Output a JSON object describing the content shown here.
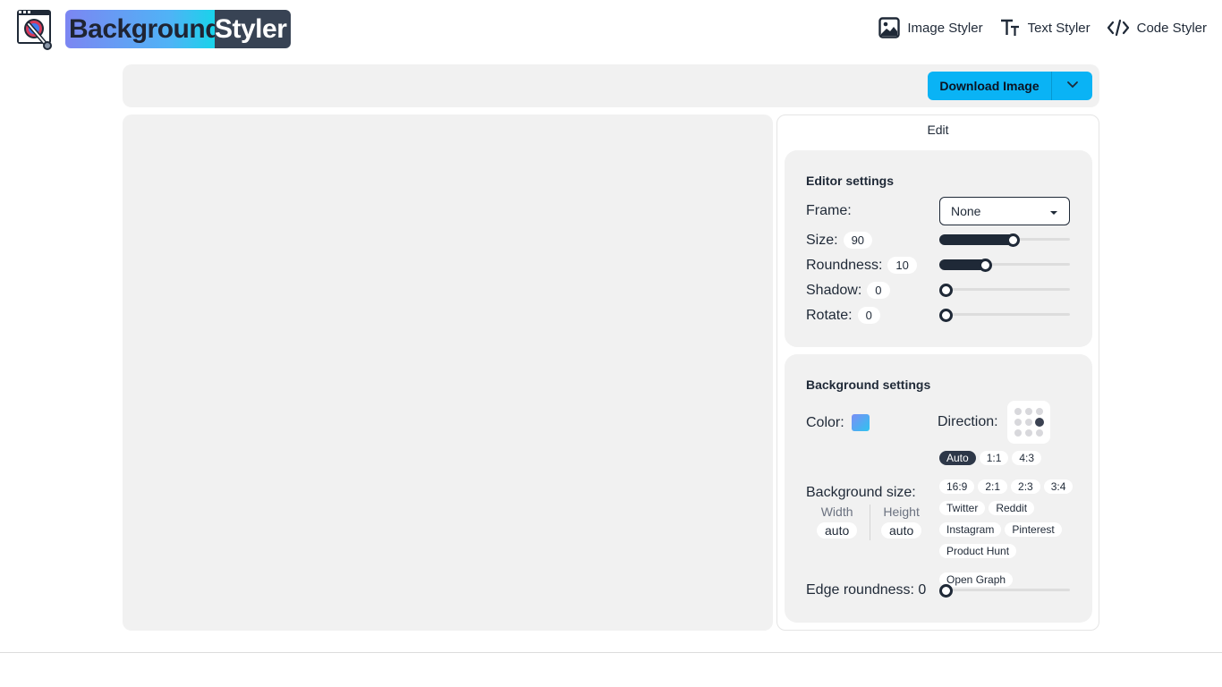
{
  "app": {
    "logo_part1": "Background",
    "logo_part2": "Styler"
  },
  "nav": [
    {
      "label": "Image Styler",
      "icon": "image-icon"
    },
    {
      "label": "Text Styler",
      "icon": "text-icon"
    },
    {
      "label": "Code Styler",
      "icon": "code-icon"
    }
  ],
  "toolbar": {
    "download_label": "Download Image",
    "caret_icon": "chevron-down-icon",
    "accent_color": "#0ab3f5"
  },
  "panel": {
    "tab_label": "Edit",
    "editor": {
      "title": "Editor settings",
      "frame_label": "Frame:",
      "frame_value": "None",
      "size_label": "Size:",
      "size_value": "90",
      "size_fraction": 0.56,
      "roundness_label": "Roundness:",
      "roundness_value": "10",
      "roundness_fraction": 0.35,
      "shadow_label": "Shadow:",
      "shadow_value": "0",
      "rotate_label": "Rotate:",
      "rotate_value": "0"
    },
    "background": {
      "title": "Background settings",
      "color_label": "Color:",
      "direction_label": "Direction:",
      "size_label": "Background size:",
      "width_caption": "Width",
      "width_value": "auto",
      "height_caption": "Height",
      "height_value": "auto",
      "ratios": [
        "Auto",
        "1:1",
        "4:3",
        "16:9",
        "2:1",
        "2:3",
        "3:4",
        "Twitter",
        "Reddit",
        "Instagram",
        "Pinterest",
        "Product Hunt",
        "Open Graph"
      ],
      "active_ratio": "Auto",
      "edge_label": "Edge roundness: 0"
    }
  }
}
